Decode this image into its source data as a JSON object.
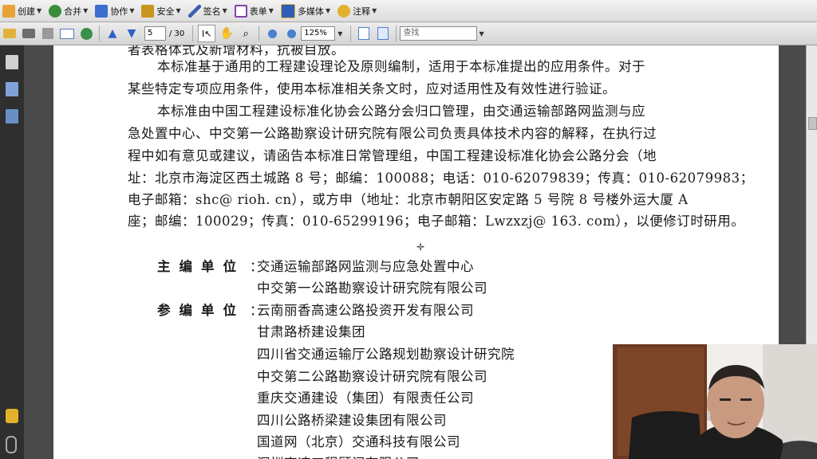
{
  "toolbar": {
    "items": [
      {
        "label": "创建",
        "icon": "create-icon",
        "color": "#e8a23a"
      },
      {
        "label": "合并",
        "icon": "combine-icon",
        "color": "#3b8d3b"
      },
      {
        "label": "协作",
        "icon": "collaborate-icon",
        "color": "#3a6fd0"
      },
      {
        "label": "安全",
        "icon": "lock-icon",
        "color": "#c8961e"
      },
      {
        "label": "签名",
        "icon": "pen-icon",
        "color": "#3b5fb0"
      },
      {
        "label": "表单",
        "icon": "form-icon",
        "color": "#8a3fa8"
      },
      {
        "label": "多媒体",
        "icon": "multimedia-icon",
        "color": "#2d5db8"
      },
      {
        "label": "注释",
        "icon": "comment-icon",
        "color": "#e3b12c"
      }
    ]
  },
  "nav": {
    "current_page": "5",
    "total_pages": "/ 30",
    "zoom": "125%",
    "find_placeholder": "查找"
  },
  "document": {
    "top_partial": "者表格体式及新增材料，抗被目放。",
    "para1_lines": [
      "本标准基于通用的工程建设理论及原则编制，适用于本标准提出的应用条件。对于",
      "某些特定专项应用条件，使用本标准相关条文时，应对适用性及有效性进行验证。"
    ],
    "para2_lines": [
      "本标准由中国工程建设标准化协会公路分会归口管理，由交通运输部路网监测与应",
      "急处置中心、中交第一公路勘察设计研究院有限公司负责具体技术内容的解释，在执行过",
      "程中如有意见或建议，请函告本标准日常管理组，中国工程建设标准化协会公路分会（地",
      "址：北京市海淀区西土城路 8 号；邮编：100088；电话：010-62079839；传真：010-62079983；",
      "电子邮箱：shc@ rioh. cn），或方申（地址：北京市朝阳区安定路 5 号院 8 号楼外运大厦 A",
      "座；邮编：100029；传真：010-65299196；电子邮箱：Lwzxzj@ 163. com），以便修订时研用。"
    ],
    "chief_label": "主编单位",
    "chief_orgs": [
      "交通运输部路网监测与应急处置中心",
      "中交第一公路勘察设计研究院有限公司"
    ],
    "participant_label": "参编单位",
    "participant_orgs": [
      "云南丽香高速公路投资开发有限公司",
      "甘肃路桥建设集团",
      "四川省交通运输厅公路规划勘察设计研究院",
      "中交第二公路勘察设计研究院有限公司",
      "重庆交通建设（集团）有限责任公司",
      "四川公路桥梁建设集团有限公司",
      "国道网（北京）交通科技有限公司",
      "深圳高速工程顾问有限公司"
    ],
    "colon": "："
  }
}
